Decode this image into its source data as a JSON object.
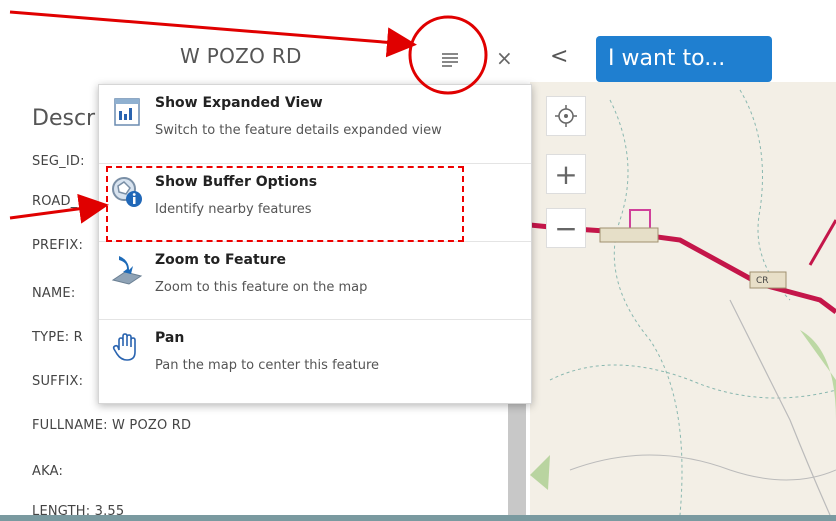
{
  "header": {
    "title": "W POZO RD",
    "close_glyph": "×"
  },
  "panel": {
    "section_title": "Descr",
    "fields": [
      {
        "label": "SEG_ID:"
      },
      {
        "label": "ROAD_"
      },
      {
        "label": "PREFIX:"
      },
      {
        "label": "NAME:"
      },
      {
        "label": "TYPE: R"
      },
      {
        "label": "SUFFIX:"
      },
      {
        "label": "FULLNAME:  W POZO RD"
      },
      {
        "label": "AKA:"
      },
      {
        "label": "LENGTH:  3.55"
      }
    ]
  },
  "menu": {
    "items": [
      {
        "label": "Show Expanded View",
        "desc": "Switch to the feature details expanded view",
        "icon": "expanded-view-icon"
      },
      {
        "label": "Show Buffer Options",
        "desc": "Identify nearby features",
        "icon": "buffer-options-icon"
      },
      {
        "label": "Zoom to Feature",
        "desc": "Zoom to this feature on the map",
        "icon": "zoom-to-feature-icon"
      },
      {
        "label": "Pan",
        "desc": "Pan the map to center this feature",
        "icon": "pan-hand-icon"
      }
    ]
  },
  "map": {
    "back_glyph": "<",
    "i_want_label": "I want to...",
    "zoom_in_glyph": "+",
    "zoom_out_glyph": "−",
    "map_label_fragment": "CR"
  },
  "colors": {
    "accent_blue": "#1f7fd0",
    "annotation_red": "#e00000",
    "road_red": "#c4164a"
  }
}
